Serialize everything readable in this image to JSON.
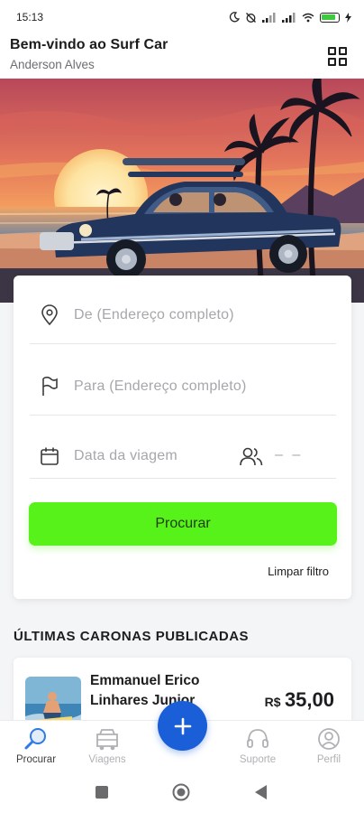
{
  "status_bar": {
    "time": "15:13",
    "battery": "100"
  },
  "header": {
    "title": "Bem-vindo ao Surf Car",
    "subtitle": "Anderson Alves"
  },
  "hero": {
    "description": "Vintage blue car with surfboard on the beach at sunset with palm trees"
  },
  "search": {
    "from_placeholder": "De (Endereço completo)",
    "to_placeholder": "Para (Endereço completo)",
    "date_placeholder": "Data da viagem",
    "passengers_value": "– –",
    "search_label": "Procurar",
    "clear_label": "Limpar filtro"
  },
  "rides": {
    "section_title": "ÚLTIMAS CARONAS PUBLICADAS",
    "items": [
      {
        "driver_name": "Emmanuel Erico Linhares Junior",
        "currency": "R$",
        "price": "35,00"
      }
    ]
  },
  "bottom_nav": {
    "items": [
      {
        "label": "Procurar",
        "icon": "search-icon",
        "active": true
      },
      {
        "label": "Viagens",
        "icon": "car-icon",
        "active": false
      },
      {
        "label": "Suporte",
        "icon": "headset-icon",
        "active": false
      },
      {
        "label": "Perfil",
        "icon": "user-icon",
        "active": false
      }
    ],
    "fab_icon": "plus-icon"
  },
  "colors": {
    "accent_green": "#58f21b",
    "fab_blue": "#1a5fd8"
  }
}
